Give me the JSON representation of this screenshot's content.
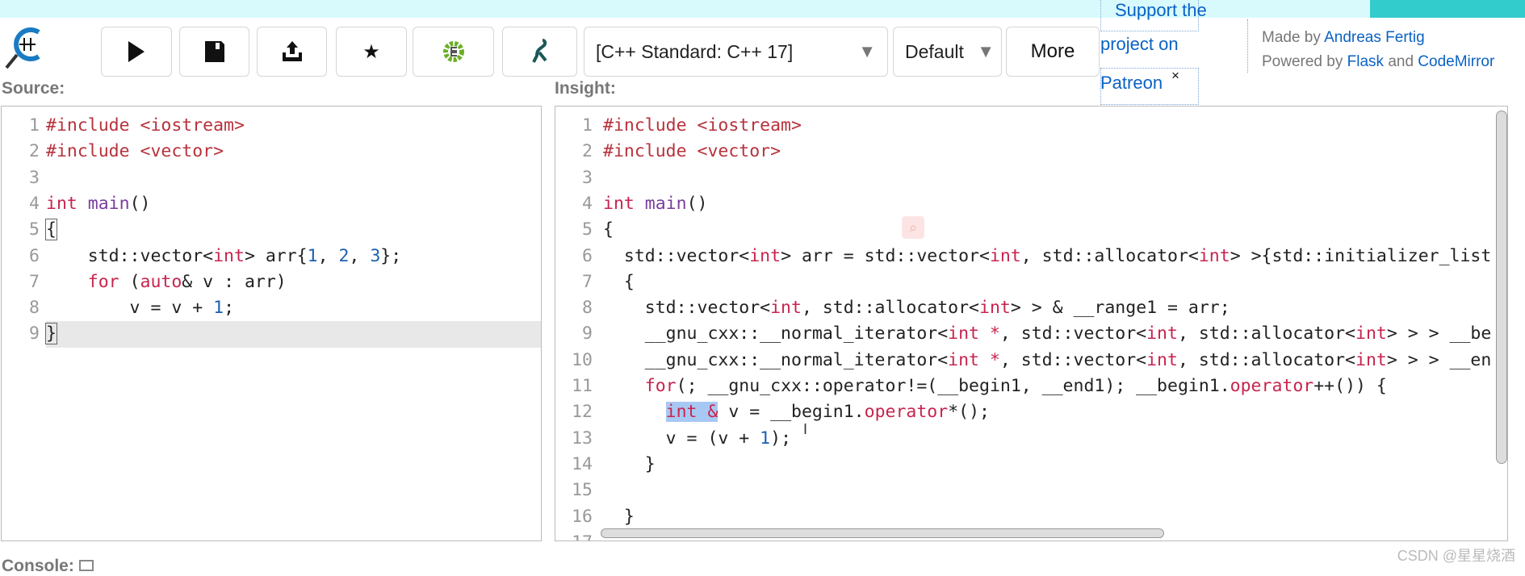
{
  "toolbar": {
    "standard_select": "[C++ Standard: C++ 17]",
    "style_select": "Default",
    "more_label": "More"
  },
  "patreon": {
    "line1": "Support the",
    "line2": "project on",
    "line3": "Patreon",
    "close": "×"
  },
  "credits": {
    "made_by": "Made by",
    "author": "Andreas Fertig",
    "powered_by": "Powered by",
    "flask": "Flask",
    "and": "and",
    "codemirror": "CodeMirror"
  },
  "labels": {
    "source": "Source:",
    "insight": "Insight:",
    "console": "Console:"
  },
  "watermark": "CSDN @星星烧酒",
  "colors": {
    "accent_band": "#d9fafd",
    "teal": "#33cccc",
    "link": "#0b62c4",
    "keyword": "#c7254e",
    "number": "#1a5fb4",
    "function": "#7a3e9d"
  },
  "source": {
    "active_line": 9,
    "lines": [
      [
        [
          "m",
          "#include <iostream>"
        ]
      ],
      [
        [
          "m",
          "#include <vector>"
        ]
      ],
      [],
      [
        [
          "k",
          "int"
        ],
        [
          "t",
          " "
        ],
        [
          "f",
          "main"
        ],
        [
          "t",
          "()"
        ]
      ],
      [
        [
          "bm",
          "{"
        ]
      ],
      [
        [
          "t",
          "    std::vector<"
        ],
        [
          "k",
          "int"
        ],
        [
          "t",
          "> arr{"
        ],
        [
          "n",
          "1"
        ],
        [
          "t",
          ", "
        ],
        [
          "n",
          "2"
        ],
        [
          "t",
          ", "
        ],
        [
          "n",
          "3"
        ],
        [
          "t",
          "};"
        ]
      ],
      [
        [
          "t",
          "    "
        ],
        [
          "k",
          "for"
        ],
        [
          "t",
          " ("
        ],
        [
          "k",
          "auto"
        ],
        [
          "t",
          "& v : arr)"
        ]
      ],
      [
        [
          "t",
          "        v = v + "
        ],
        [
          "n",
          "1"
        ],
        [
          "t",
          ";"
        ]
      ],
      [
        [
          "bm",
          "}"
        ]
      ]
    ]
  },
  "insight": {
    "lines": [
      [
        [
          "m",
          "#include <iostream>"
        ]
      ],
      [
        [
          "m",
          "#include <vector>"
        ]
      ],
      [],
      [
        [
          "k",
          "int"
        ],
        [
          "t",
          " "
        ],
        [
          "f",
          "main"
        ],
        [
          "t",
          "()"
        ]
      ],
      [
        [
          "t",
          "{"
        ]
      ],
      [
        [
          "t",
          "  std::vector<"
        ],
        [
          "k",
          "int"
        ],
        [
          "t",
          "> arr = std::vector<"
        ],
        [
          "k",
          "int"
        ],
        [
          "t",
          ", std::allocator<"
        ],
        [
          "k",
          "int"
        ],
        [
          "t",
          "> >{std::initializer_list"
        ]
      ],
      [
        [
          "t",
          "  {"
        ]
      ],
      [
        [
          "t",
          "    std::vector<"
        ],
        [
          "k",
          "int"
        ],
        [
          "t",
          ", std::allocator<"
        ],
        [
          "k",
          "int"
        ],
        [
          "t",
          "> > & __range1 = arr;"
        ]
      ],
      [
        [
          "t",
          "    __gnu_cxx::__normal_iterator<"
        ],
        [
          "k",
          "int *"
        ],
        [
          "t",
          ", std::vector<"
        ],
        [
          "k",
          "int"
        ],
        [
          "t",
          ", std::allocator<"
        ],
        [
          "k",
          "int"
        ],
        [
          "t",
          "> > > __be"
        ]
      ],
      [
        [
          "t",
          "    __gnu_cxx::__normal_iterator<"
        ],
        [
          "k",
          "int *"
        ],
        [
          "t",
          ", std::vector<"
        ],
        [
          "k",
          "int"
        ],
        [
          "t",
          ", std::allocator<"
        ],
        [
          "k",
          "int"
        ],
        [
          "t",
          "> > > __en"
        ]
      ],
      [
        [
          "t",
          "    "
        ],
        [
          "k",
          "for"
        ],
        [
          "t",
          "(; __gnu_cxx::operator!=(__begin1, __end1); __begin1."
        ],
        [
          "o",
          "operator"
        ],
        [
          "t",
          "++()) {"
        ]
      ],
      [
        [
          "t",
          "      "
        ],
        [
          "s",
          "int &"
        ],
        [
          "t",
          " v = __begin1."
        ],
        [
          "o",
          "operator"
        ],
        [
          "t",
          "*();"
        ]
      ],
      [
        [
          "t",
          "      v = (v + "
        ],
        [
          "n",
          "1"
        ],
        [
          "t",
          ");"
        ]
      ],
      [
        [
          "t",
          "    }"
        ]
      ],
      [],
      [
        [
          "t",
          "  }"
        ]
      ],
      []
    ]
  }
}
